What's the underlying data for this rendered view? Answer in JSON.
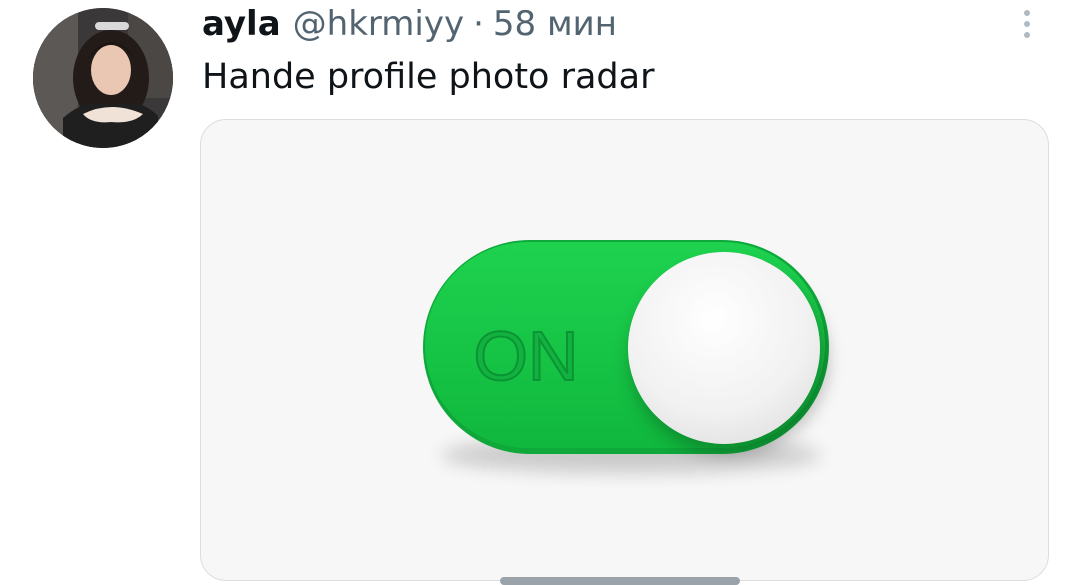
{
  "tweet": {
    "author": {
      "display_name": "ayla",
      "handle": "@hkrmiyy"
    },
    "separator": "·",
    "time": "58 мин",
    "text": "Hande profile photo radar",
    "more_icon": "more-vertical-icon",
    "media": {
      "image_subject": "toggle-switch",
      "toggle_label": "ON",
      "toggle_state": "on",
      "colors": {
        "track": "#16c746",
        "track_dark": "#0fa83a",
        "knob": "#f4f4f4",
        "card_background": "#f7f7f7"
      }
    }
  }
}
